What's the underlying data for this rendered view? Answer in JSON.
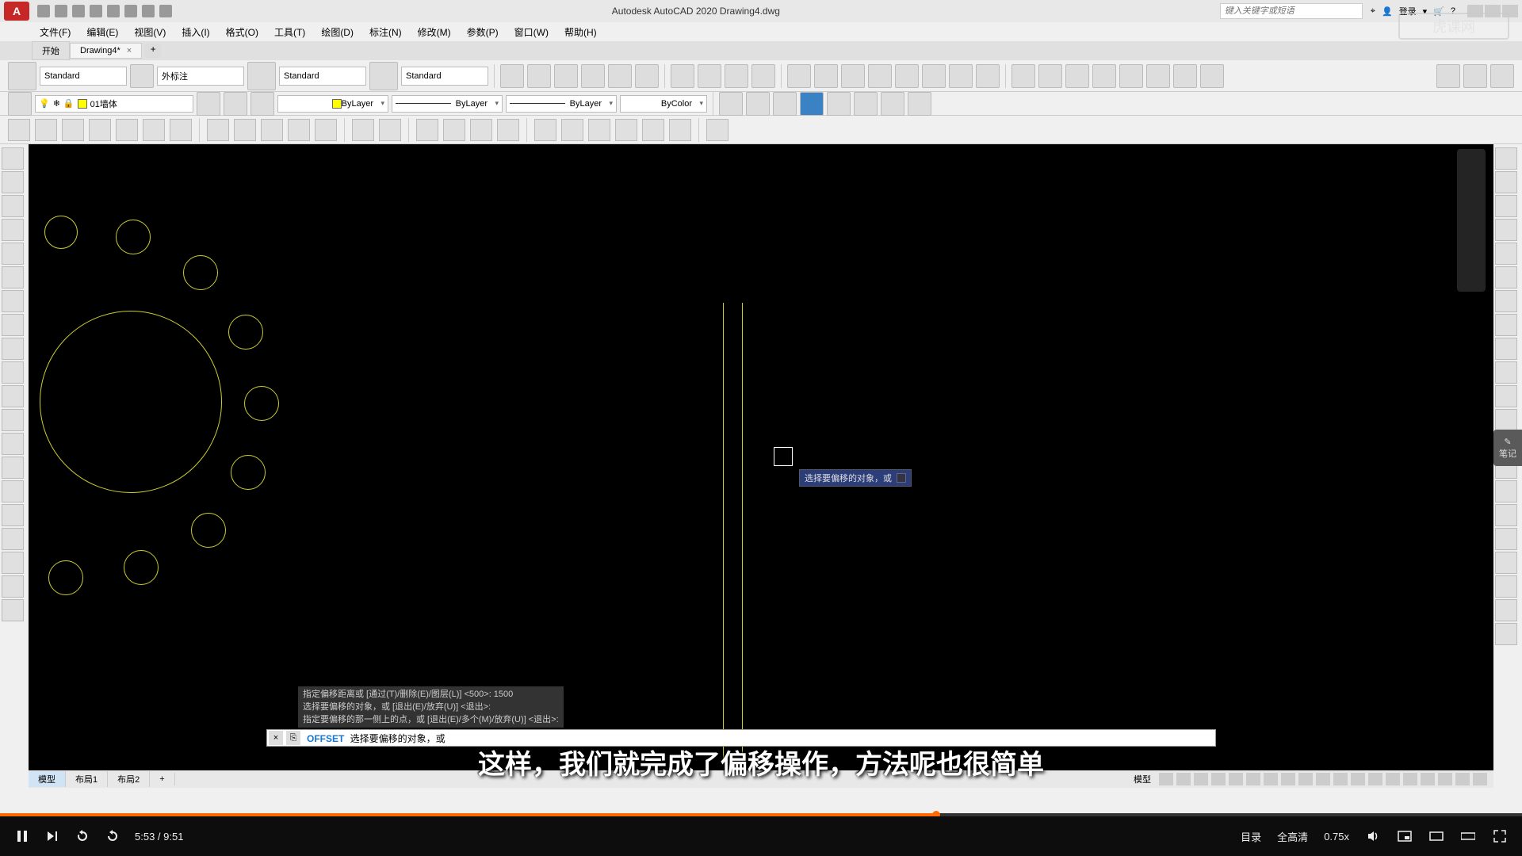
{
  "app": {
    "title_full": "Autodesk AutoCAD 2020    Drawing4.dwg",
    "logo_letter": "A",
    "search_placeholder": "键入关键字或短语",
    "login": "登录"
  },
  "menu": {
    "file": "文件(F)",
    "edit": "编辑(E)",
    "view": "视图(V)",
    "insert": "插入(I)",
    "format": "格式(O)",
    "tools": "工具(T)",
    "draw": "绘图(D)",
    "dimension": "标注(N)",
    "modify": "修改(M)",
    "param": "参数(P)",
    "window": "窗口(W)",
    "help": "帮助(H)"
  },
  "doc_tabs": {
    "start": "开始",
    "active": "Drawing4*",
    "close": "×",
    "add": "+"
  },
  "ribbon": {
    "style_standard": "Standard",
    "style_external": "外标注"
  },
  "layers": {
    "current": "01墙体",
    "bylayer": "ByLayer",
    "bycolor": "ByColor"
  },
  "layout": {
    "model": "模型",
    "layout1": "布局1",
    "layout2": "布局2",
    "add": "+"
  },
  "cmd": {
    "h1": "指定偏移距离或 [通过(T)/删除(E)/图层(L)] <500>:  1500",
    "h2": "选择要偏移的对象，或 [退出(E)/放弃(U)] <退出>:",
    "h3": "指定要偏移的那一侧上的点，或 [退出(E)/多个(M)/放弃(U)] <退出>:",
    "name": "OFFSET",
    "prompt": "选择要偏移的对象，或",
    "dyn_tip": "选择要偏移的对象，或"
  },
  "subtitle_text": "这样，我们就完成了偏移操作，方法呢也很简单",
  "watermark_text": "虎课网",
  "notes_label": "笔记",
  "player": {
    "current_time": "5:53",
    "total_time": "9:51",
    "time_sep": " / ",
    "toc": "目录",
    "quality": "全高清",
    "speed": "0.75x"
  }
}
